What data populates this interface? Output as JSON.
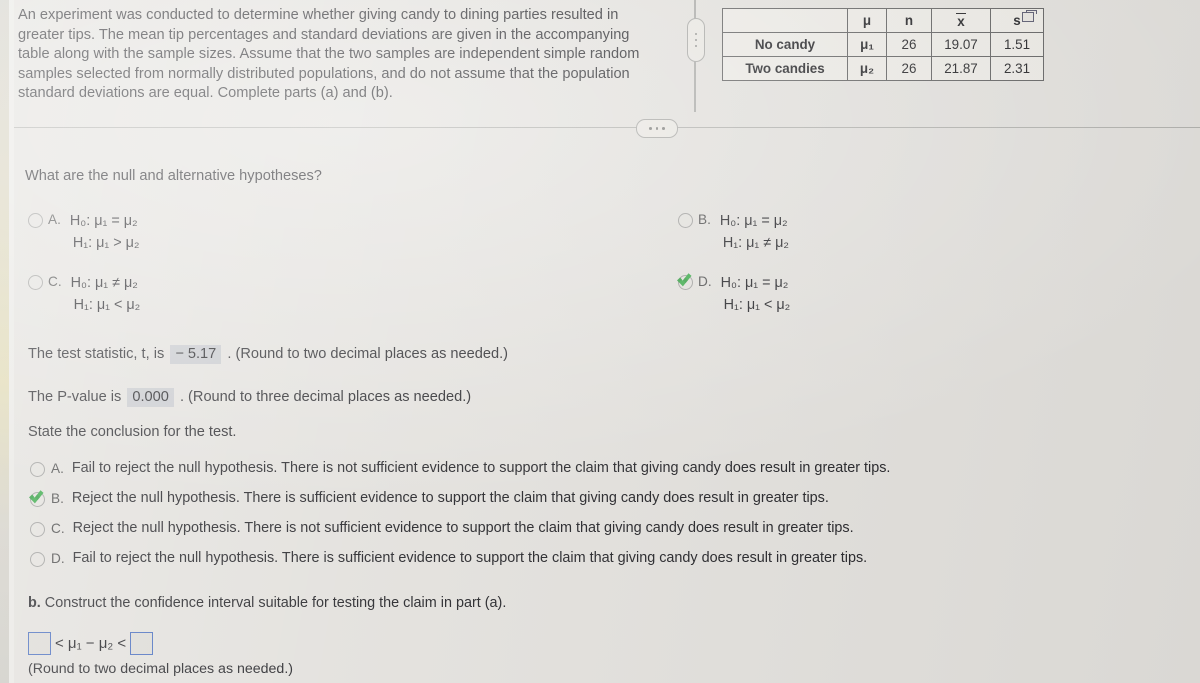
{
  "problem": {
    "stem": "An experiment was conducted to determine whether giving candy to dining parties resulted in greater tips. The mean tip percentages and standard deviations are given in the accompanying table along with the sample sizes. Assume that the two samples are independent simple random samples selected from normally distributed populations, and do not assume that the population standard deviations are equal. Complete parts (a) and (b)."
  },
  "data_table": {
    "columns": [
      "",
      "μ",
      "n",
      "x̄",
      "s"
    ],
    "rows": [
      {
        "label": "No candy",
        "mu": "μ₁",
        "n": "26",
        "xbar": "19.07",
        "s": "1.51"
      },
      {
        "label": "Two candies",
        "mu": "μ₂",
        "n": "26",
        "xbar": "21.87",
        "s": "2.31"
      }
    ],
    "popout_icon": "open-in-new-window-icon"
  },
  "divider": {
    "ellipsis_label": "•••",
    "drag_handle": "vertical-drag-handle"
  },
  "hypotheses": {
    "prompt": "What are the null and alternative hypotheses?",
    "options": [
      {
        "key": "A.",
        "null": "H₀: μ₁ = μ₂",
        "alt": "H₁: μ₁ > μ₂",
        "selected": false
      },
      {
        "key": "B.",
        "null": "H₀: μ₁ = μ₂",
        "alt": "H₁: μ₁ ≠ μ₂",
        "selected": false
      },
      {
        "key": "C.",
        "null": "H₀: μ₁ ≠ μ₂",
        "alt": "H₁: μ₁ < μ₂",
        "selected": false
      },
      {
        "key": "D.",
        "null": "H₀: μ₁ = μ₂",
        "alt": "H₁: μ₁ < μ₂",
        "selected": true
      }
    ]
  },
  "test_statistic": {
    "prefix": "The test statistic, t, is",
    "value": "− 5.17",
    "suffix": ". (Round to two decimal places as needed.)"
  },
  "p_value": {
    "prefix": "The P-value is",
    "value": "0.000",
    "suffix": ". (Round to three decimal places as needed.)"
  },
  "conclusion": {
    "prompt": "State the conclusion for the test.",
    "options": [
      {
        "key": "A.",
        "text": "Fail to reject the null hypothesis. There is not sufficient evidence to support the claim that giving candy does result in greater tips.",
        "selected": false
      },
      {
        "key": "B.",
        "text": "Reject the null hypothesis. There is sufficient evidence to support the claim that giving candy does result in greater tips.",
        "selected": true
      },
      {
        "key": "C.",
        "text": "Reject the null hypothesis. There is not sufficient evidence to support the claim that giving candy does result in greater tips.",
        "selected": false
      },
      {
        "key": "D.",
        "text": "Fail to reject the null hypothesis. There is sufficient evidence to support the claim that giving candy does result in greater tips.",
        "selected": false
      }
    ]
  },
  "part_b": {
    "prompt": "b. Construct the confidence interval suitable for testing the claim in part (a).",
    "lower_value": "",
    "upper_value": "",
    "middle_expression": "< μ₁ − μ₂ <",
    "round_note": "(Round to two decimal places as needed.)"
  },
  "colors": {
    "background": "#e2e0dc",
    "answer_highlight": "#c6c8cc",
    "selected_check": "#36a845",
    "input_border": "#4b6fbe",
    "text": "#26262a"
  }
}
